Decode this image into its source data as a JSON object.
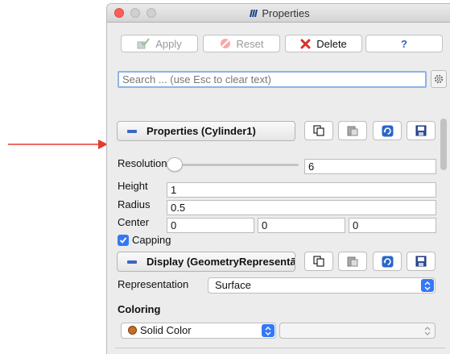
{
  "window": {
    "title": "Properties"
  },
  "toolbar": {
    "apply_label": "Apply",
    "reset_label": "Reset",
    "delete_label": "Delete",
    "help_label": "?"
  },
  "search": {
    "placeholder": "Search ... (use Esc to clear text)"
  },
  "properties_section": {
    "title": "Properties (Cylinder1)",
    "resolution": {
      "label": "Resolution",
      "value": "6"
    },
    "height": {
      "label": "Height",
      "value": "1"
    },
    "radius": {
      "label": "Radius",
      "value": "0.5"
    },
    "center": {
      "label": "Center",
      "x": "0",
      "y": "0",
      "z": "0"
    },
    "capping": {
      "label": "Capping",
      "checked": true
    }
  },
  "display_section": {
    "title": "Display (GeometryRepresentā",
    "representation": {
      "label": "Representation",
      "value": "Surface"
    },
    "coloring": {
      "label": "Coloring",
      "value": "Solid Color",
      "secondary_value": ""
    }
  },
  "colors": {
    "accent": "#3478f6",
    "arrow": "#e53b2e",
    "solid_color_swatch": "#c86f21"
  }
}
